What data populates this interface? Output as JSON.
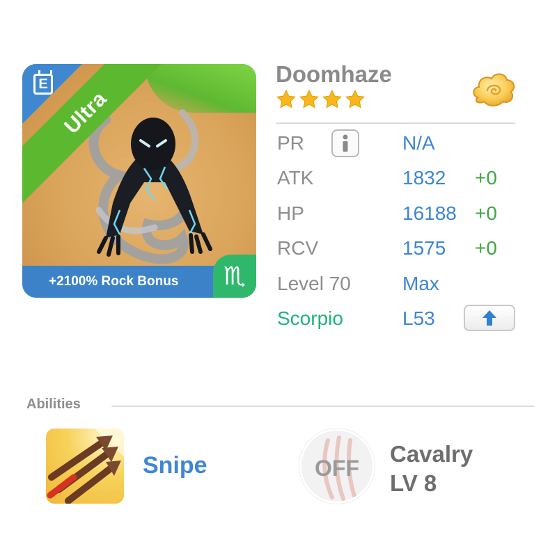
{
  "monster": {
    "name": "Doomhaze",
    "stars": 4,
    "rarity_label": "Ultra",
    "bonus_text": "+2100% Rock Bonus",
    "zodiac_symbol": "♏",
    "badge_letter": "E",
    "element_icon": "cloud-element-icon"
  },
  "stats": {
    "pr": {
      "label": "PR",
      "value": "N/A"
    },
    "atk": {
      "label": "ATK",
      "value": "1832",
      "bonus": "+0"
    },
    "hp": {
      "label": "HP",
      "value": "16188",
      "bonus": "+0"
    },
    "rcv": {
      "label": "RCV",
      "value": "1575",
      "bonus": "+0"
    },
    "level": {
      "label": "Level 70",
      "value": "Max"
    },
    "zodiac": {
      "label": "Scorpio",
      "value": "L53"
    }
  },
  "abilities": {
    "title": "Abilities",
    "active": {
      "name": "Snipe",
      "icon": "arrows-icon"
    },
    "passive": {
      "status": "OFF",
      "name": "Cavalry",
      "level": "LV 8",
      "icon": "claw-marks-icon"
    }
  },
  "colors": {
    "stat_value": "#3d86d4",
    "stat_bonus": "#3fa645",
    "zodiac_label": "#1fb27a",
    "ribbon": "#5cb82e",
    "bottom_bar": "#3c82c8"
  }
}
